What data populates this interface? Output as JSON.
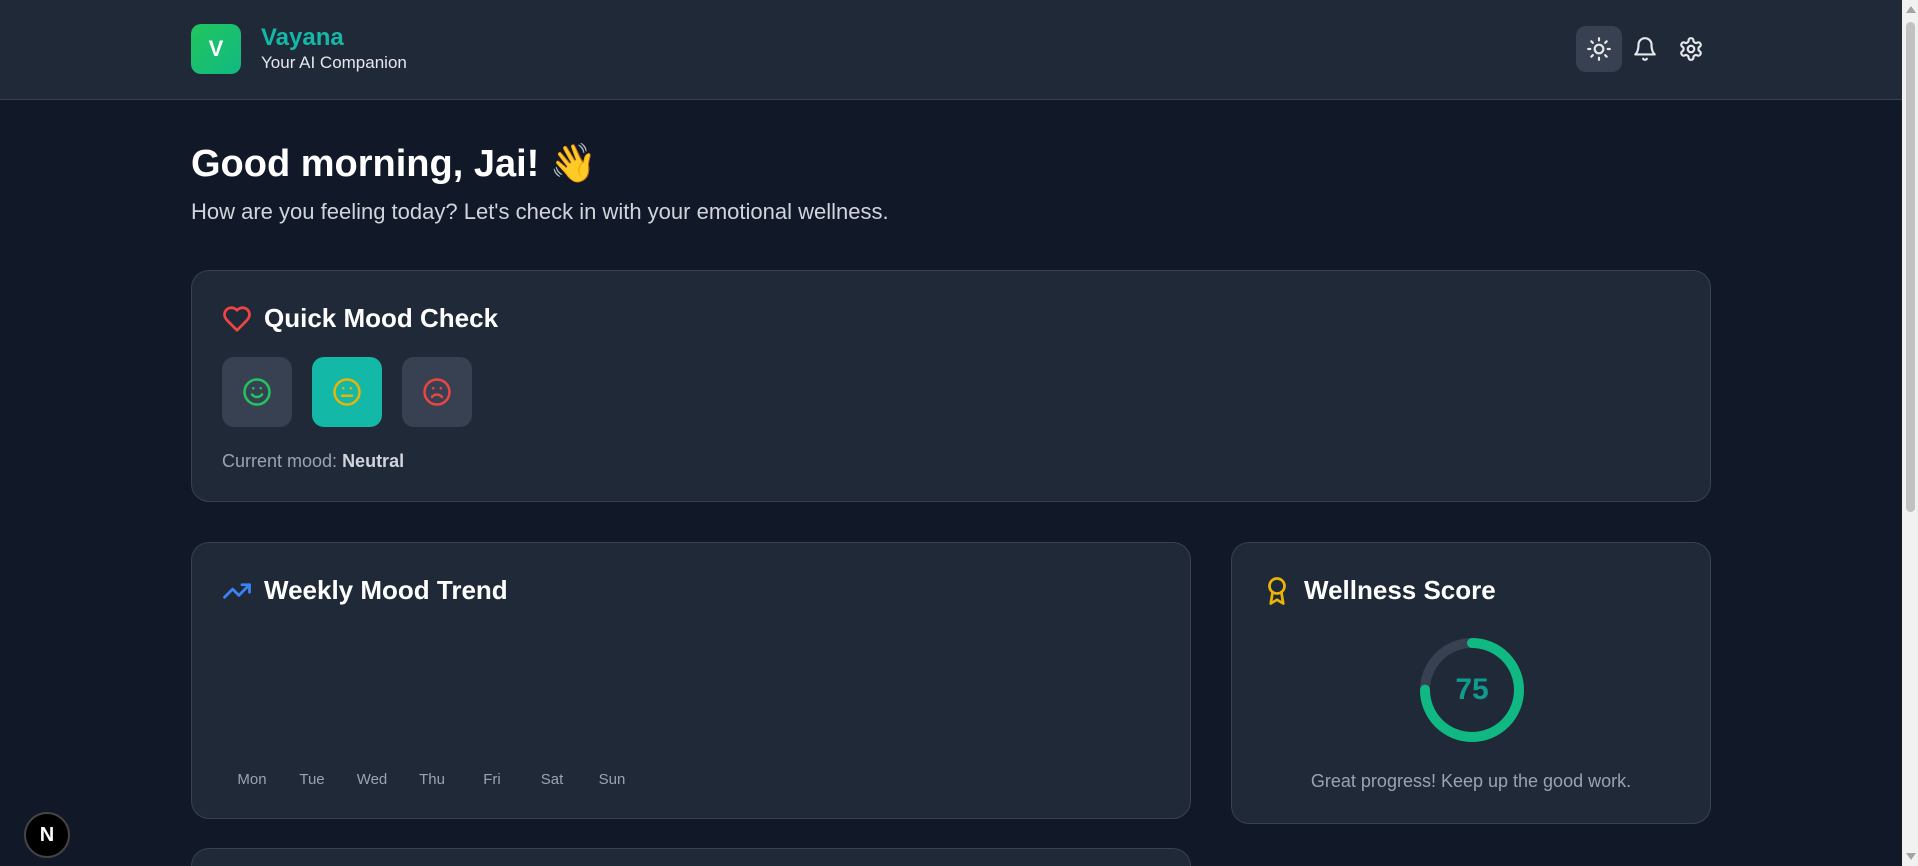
{
  "header": {
    "logo_letter": "V",
    "app_name": "Vayana",
    "tagline": "Your AI Companion",
    "actions": [
      {
        "name": "theme-toggle",
        "icon": "sun-icon"
      },
      {
        "name": "notifications",
        "icon": "bell-icon"
      },
      {
        "name": "settings",
        "icon": "gear-icon"
      }
    ]
  },
  "greeting": {
    "title": "Good morning, Jai! 👋",
    "subtitle": "How are you feeling today? Let's check in with your emotional wellness."
  },
  "mood_check": {
    "title": "Quick Mood Check",
    "icon": "heart-icon",
    "options": [
      {
        "name": "happy",
        "icon": "smile-icon",
        "color": "#22c55e",
        "selected": false
      },
      {
        "name": "neutral",
        "icon": "meh-icon",
        "color": "#eab308",
        "selected": true
      },
      {
        "name": "sad",
        "icon": "frown-icon",
        "color": "#ef4444",
        "selected": false
      }
    ],
    "status_label": "Current mood: ",
    "status_value": "Neutral"
  },
  "weekly_trend": {
    "title": "Weekly Mood Trend",
    "icon": "trending-up-icon",
    "days": [
      "Mon",
      "Tue",
      "Wed",
      "Thu",
      "Fri",
      "Sat",
      "Sun"
    ]
  },
  "wellness": {
    "title": "Wellness Score",
    "icon": "award-icon",
    "score": "75",
    "score_fraction": 0.75,
    "message": "Great progress! Keep up the good work."
  },
  "next_badge": "N",
  "colors": {
    "accent": "#14b8a6",
    "background": "#111827",
    "card": "#1f2937"
  }
}
